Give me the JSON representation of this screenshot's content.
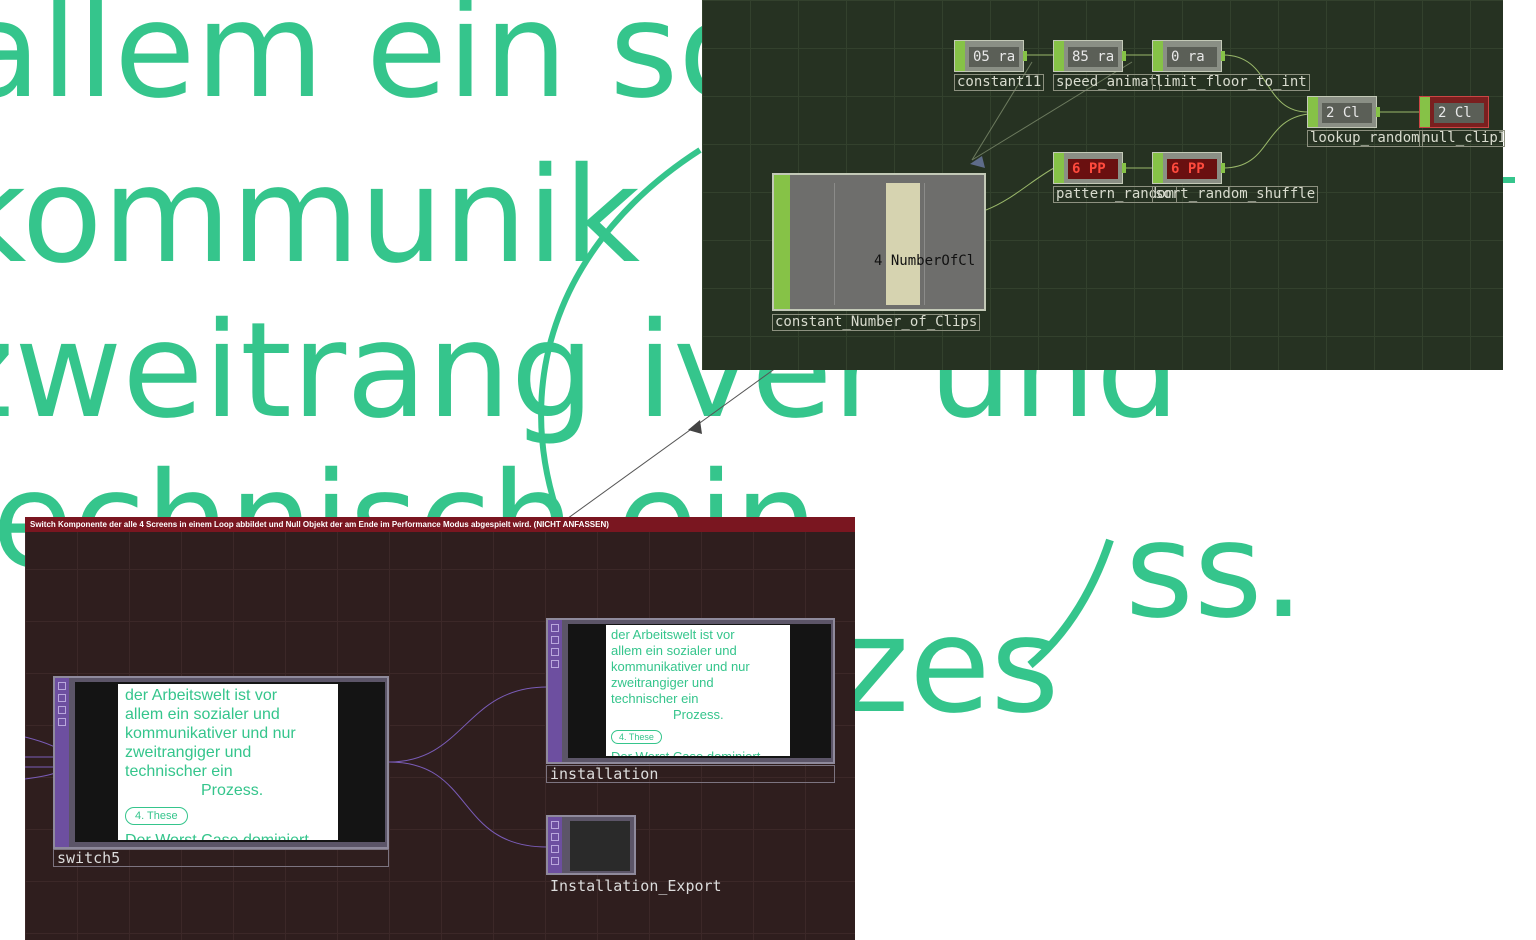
{
  "background_text": {
    "line1": "allem ein so",
    "line2": "kommunik",
    "line3": "zweitrang iver und",
    "line4": "technisch ein",
    "line5": "ss.",
    "line6": "zes"
  },
  "green_network": {
    "nodes": [
      {
        "value": "05 ra",
        "label": "constant11"
      },
      {
        "value": "85 ra",
        "label": "speed_animat"
      },
      {
        "value": "0 ra",
        "label": "limit_floor_to_int"
      },
      {
        "value": "2 Cl",
        "label": "lookup_random"
      },
      {
        "value": "2 Cl",
        "label": "null_clipIndex"
      },
      {
        "value": "6 PP",
        "label": "pattern_random"
      },
      {
        "value": "6 PP",
        "label": "sort_random_shuffle"
      }
    ],
    "big_node": {
      "value": "4 NumberOfCl",
      "label": "constant_Number_of_Clips"
    }
  },
  "red_network": {
    "title": "Switch Komponente der alle 4 Screens in einem Loop abbildet und Null Objekt der am Ende im Performance Modus abgespielt wird. (NICHT ANFASSEN)",
    "preview_lines": [
      "der Arbeitswelt ist vor",
      "allem ein sozialer und",
      "kommunikativer und nur",
      "zweitrangiger und",
      "technischer ein",
      "Prozess."
    ],
    "preview_pill": "4. These",
    "preview_footer": "Der Worst Case dominiert",
    "switch_label": "switch5",
    "installation_label": "installation",
    "export_label": "Installation_Export"
  }
}
